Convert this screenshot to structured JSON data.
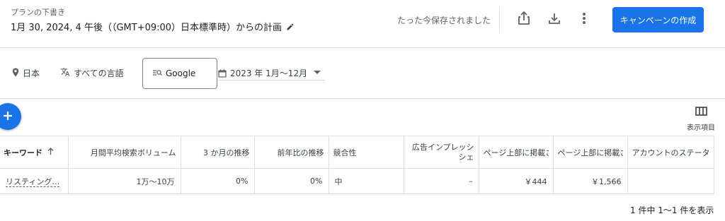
{
  "header": {
    "draft_label": "プランの下書き",
    "plan_title": "1月 30, 2024, 4 午後（（GMT+09:00）日本標準時）からの計画",
    "saved_status": "たった今保存されました",
    "create_button": "キャンペーンの作成",
    "icons": [
      "pencil-icon",
      "share-icon",
      "download-icon",
      "more-vert-icon"
    ]
  },
  "filters": {
    "location": "日本",
    "language": "すべての言語",
    "network": "Google",
    "date_range": "2023 年 1月～12月"
  },
  "actions": {
    "columns_label": "表示項目"
  },
  "table": {
    "headers": [
      "キーワード",
      "月間平均検索ボリューム",
      "3 か月の推移",
      "前年比の推移",
      "競合性",
      "広告インプレッシ\nシェ",
      "ページ上部に掲載さ",
      "ページ上部に掲載さ",
      "アカウントのステータス"
    ],
    "rows": [
      [
        "リスティング…",
        "1万～10万",
        "0%",
        "0%",
        "中",
        "–",
        "￥444",
        "￥1,566",
        ""
      ]
    ]
  },
  "pagination": {
    "summary": "1 件中 1～1 件を表示"
  },
  "colors": {
    "accent": "#1a73e8",
    "text": "#202124",
    "muted": "#5f6368",
    "border": "#e0e0e0"
  }
}
